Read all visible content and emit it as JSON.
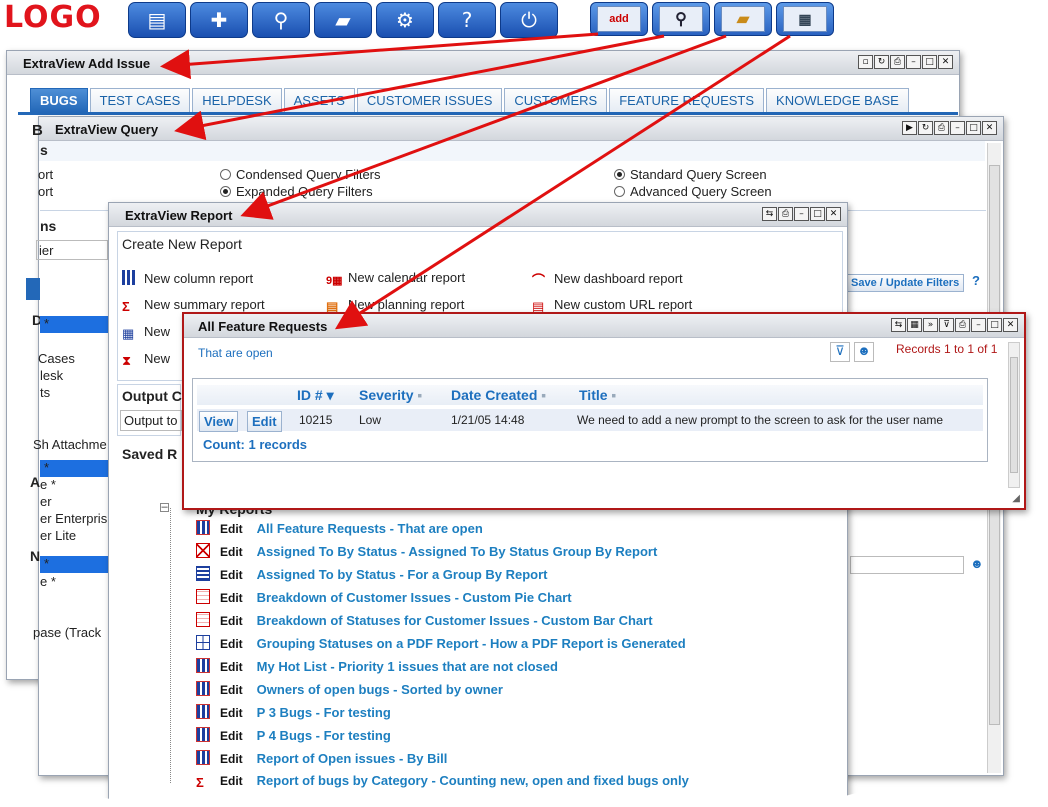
{
  "logo": "LOGO",
  "toolbar": {
    "main_icons": [
      "document-icon",
      "plus-icon",
      "search-icon",
      "folder-icon",
      "gears-icon",
      "help-icon",
      "power-icon"
    ],
    "quick_icons": [
      "add-issue-icon",
      "query-icon",
      "folder-icon",
      "report-grid-icon"
    ],
    "add_label": "add"
  },
  "add_issue": {
    "title": "ExtraView Add Issue",
    "tabs": [
      "BUGS",
      "TEST CASES",
      "HELPDESK",
      "ASSETS",
      "CUSTOMER ISSUES",
      "CUSTOMERS",
      "FEATURE REQUESTS",
      "KNOWLEDGE BASE"
    ],
    "left_fragments": [
      "B",
      "s",
      "ort",
      "ort",
      "ns",
      "ier",
      "D",
      "Cases",
      "lesk",
      "ts",
      "Sh Attachme",
      "A",
      "e *",
      "er",
      "er Enterpris",
      "er Lite",
      "N",
      "e *",
      "pase (Track"
    ]
  },
  "query": {
    "title": "ExtraView Query",
    "filter_options": [
      "Condensed Query Filters",
      "Expanded Query Filters"
    ],
    "screen_options": [
      "Standard Query Screen",
      "Advanced Query Screen"
    ],
    "save_button": "Save / Update Filters",
    "help": "?"
  },
  "report": {
    "title": "ExtraView Report",
    "create_title": "Create New Report",
    "types": [
      [
        "New column report",
        "New calendar report",
        "New dashboard report"
      ],
      [
        "New summary report",
        "New planning report",
        "New custom URL report"
      ],
      [
        "New",
        "",
        ""
      ],
      [
        "New",
        "",
        ""
      ]
    ],
    "output_title": "Output C",
    "output_to": "Output to",
    "saved_title": "Saved R",
    "my_reports": "My Reports",
    "edit_label": "Edit",
    "saved_reports": [
      {
        "icon": "column-icon",
        "title": "All Feature Requests - That are open"
      },
      {
        "icon": "matrix-icon",
        "title": "Assigned To By Status - Assigned To By Status Group By Report"
      },
      {
        "icon": "calendar-icon",
        "title": "Assigned To by Status - For a Group By Report"
      },
      {
        "icon": "chart-icon",
        "title": "Breakdown of Customer Issues - Custom Pie Chart"
      },
      {
        "icon": "chart-icon",
        "title": "Breakdown of Statuses for Customer Issues - Custom Bar Chart"
      },
      {
        "icon": "grid-icon",
        "title": "Grouping Statuses on a PDF Report - How a PDF Report is Generated"
      },
      {
        "icon": "column-icon",
        "title": "My Hot List - Priority 1 issues that are not closed"
      },
      {
        "icon": "column-icon",
        "title": "Owners of open bugs - Sorted by owner"
      },
      {
        "icon": "column-icon",
        "title": "P 3 Bugs - For testing"
      },
      {
        "icon": "column-icon",
        "title": "P 4 Bugs - For testing"
      },
      {
        "icon": "column-icon",
        "title": "Report of Open issues - By Bill"
      },
      {
        "icon": "summary-icon",
        "title": "Report of bugs by Category - Counting new, open and fixed bugs only"
      }
    ]
  },
  "feature": {
    "title": "All Feature Requests",
    "subtitle": "That are open",
    "records": "Records 1 to 1 of 1",
    "columns": [
      "ID #",
      "Severity",
      "Date Created",
      "Title"
    ],
    "row": {
      "view": "View",
      "edit": "Edit",
      "id": "10215",
      "severity": "Low",
      "date": "1/21/05 14:48",
      "title": "We need to add a new prompt to the screen to ask for the user name"
    },
    "count": "Count: 1 records"
  },
  "colors": {
    "accent": "#1d6fbe",
    "arrow": "#e01010",
    "frame_red": "#b01818"
  }
}
